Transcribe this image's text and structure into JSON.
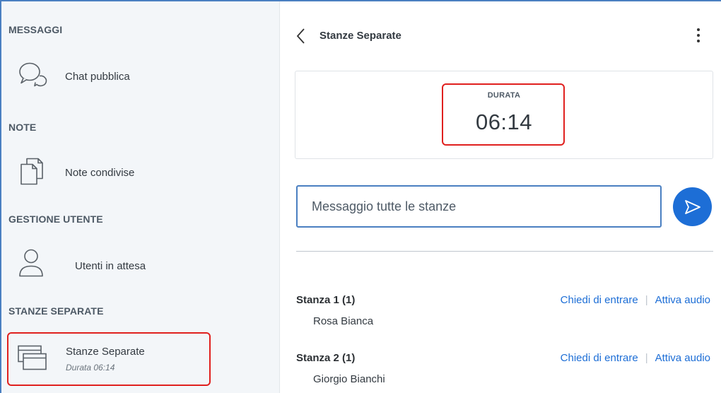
{
  "sidebar": {
    "sections": {
      "messages": "MESSAGGI",
      "notes": "NOTE",
      "user_management": "GESTIONE UTENTE",
      "breakout_rooms": "STANZE SEPARATE"
    },
    "items": [
      {
        "label": "Chat pubblica",
        "icon": "chat-bubbles-icon"
      },
      {
        "label": "Note condivise",
        "icon": "shared-notes-icon"
      },
      {
        "label": "Utenti in attesa",
        "icon": "user-icon"
      },
      {
        "label": "Stanze Separate",
        "sublabel": "Durata 06:14",
        "icon": "breakout-rooms-icon"
      }
    ]
  },
  "main": {
    "title": "Stanze Separate",
    "timer": {
      "label": "DURATA",
      "value": "06:14"
    },
    "message_input": {
      "placeholder": "Messaggio tutte le stanze",
      "value": ""
    },
    "rooms": [
      {
        "name": "Stanza 1 (1)",
        "member": "Rosa Bianca",
        "join_label": "Chiedi di entrare",
        "audio_label": "Attiva audio"
      },
      {
        "name": "Stanza 2 (1)",
        "member": "Giorgio Bianchi",
        "join_label": "Chiedi di entrare",
        "audio_label": "Attiva audio"
      }
    ]
  },
  "colors": {
    "accent": "#1d6ed6",
    "highlight": "#e0201e",
    "sidebar_bg": "#f3f6f9"
  }
}
